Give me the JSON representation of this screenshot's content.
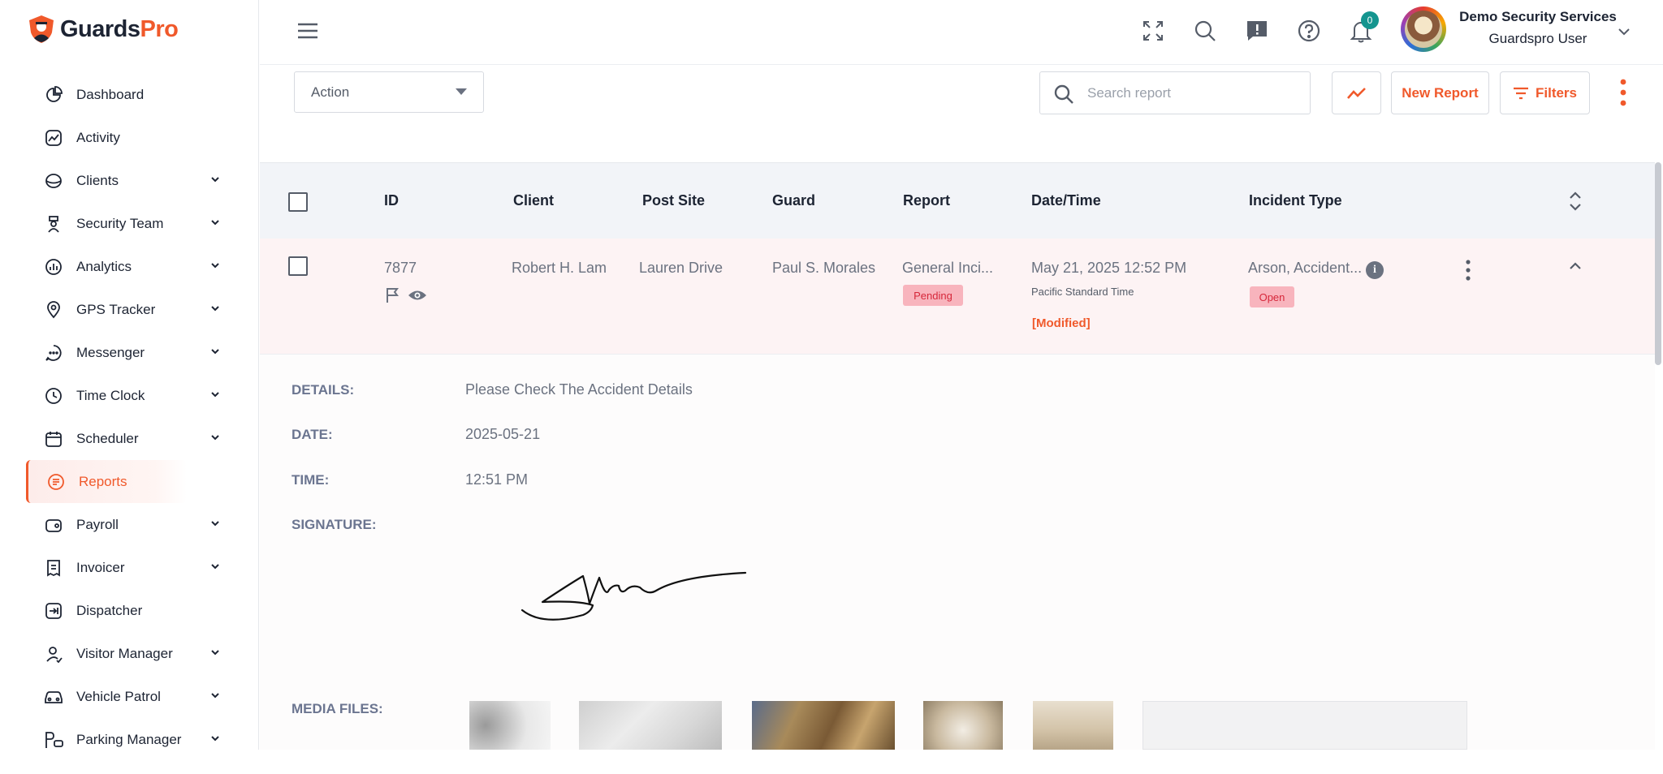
{
  "brand": {
    "name_part1": "Guards",
    "name_part2": "Pro",
    "accent": "#f0592b"
  },
  "sidebar": {
    "items": [
      {
        "label": "Dashboard",
        "icon": "pie-chart-icon",
        "has_children": false
      },
      {
        "label": "Activity",
        "icon": "activity-icon",
        "has_children": false
      },
      {
        "label": "Clients",
        "icon": "clients-icon",
        "has_children": true
      },
      {
        "label": "Security Team",
        "icon": "guard-icon",
        "has_children": true
      },
      {
        "label": "Analytics",
        "icon": "analytics-icon",
        "has_children": true
      },
      {
        "label": "GPS Tracker",
        "icon": "location-icon",
        "has_children": true
      },
      {
        "label": "Messenger",
        "icon": "chat-icon",
        "has_children": true
      },
      {
        "label": "Time Clock",
        "icon": "clock-icon",
        "has_children": true
      },
      {
        "label": "Scheduler",
        "icon": "calendar-icon",
        "has_children": true
      },
      {
        "label": "Reports",
        "icon": "report-icon",
        "has_children": false,
        "active": true
      },
      {
        "label": "Payroll",
        "icon": "wallet-icon",
        "has_children": true
      },
      {
        "label": "Invoicer",
        "icon": "invoice-icon",
        "has_children": true
      },
      {
        "label": "Dispatcher",
        "icon": "dispatch-icon",
        "has_children": false
      },
      {
        "label": "Visitor Manager",
        "icon": "visitor-icon",
        "has_children": true
      },
      {
        "label": "Vehicle Patrol",
        "icon": "car-icon",
        "has_children": true
      },
      {
        "label": "Parking Manager",
        "icon": "parking-icon",
        "has_children": true
      }
    ]
  },
  "topbar": {
    "notifications_count": "0",
    "user": {
      "company": "Demo Security Services",
      "role": "Guardspro User"
    }
  },
  "toolbar": {
    "action_label": "Action",
    "search_placeholder": "Search report",
    "new_report_label": "New Report",
    "filters_label": "Filters"
  },
  "table": {
    "headers": {
      "id": "ID",
      "client": "Client",
      "post_site": "Post Site",
      "guard": "Guard",
      "report": "Report",
      "datetime": "Date/Time",
      "incident_type": "Incident Type"
    },
    "row": {
      "id": "7877",
      "client": "Robert H. Lam",
      "post_site": "Lauren Drive",
      "guard": "Paul S. Morales",
      "report": "General Inci...",
      "report_status": "Pending",
      "datetime": "May 21, 2025 12:52 PM",
      "timezone": "Pacific Standard Time",
      "modified": "[Modified]",
      "incident_type": "Arson, Accident...",
      "incident_status": "Open"
    }
  },
  "details": {
    "details_label": "DETAILS:",
    "details_value": "Please Check The Accident Details",
    "date_label": "DATE:",
    "date_value": "2025-05-21",
    "time_label": "TIME:",
    "time_value": "12:51 PM",
    "signature_label": "SIGNATURE:",
    "media_label": "MEDIA FILES:"
  }
}
